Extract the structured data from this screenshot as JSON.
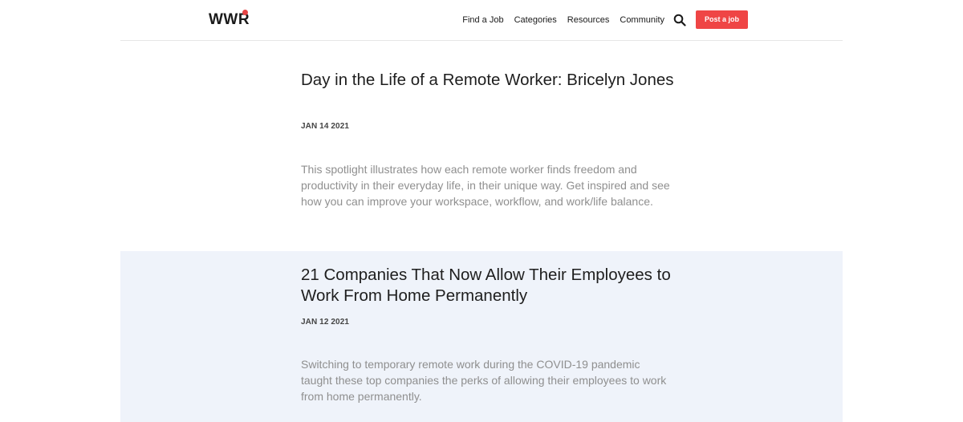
{
  "header": {
    "logo_text": "WWR",
    "nav": [
      {
        "label": "Find a Job"
      },
      {
        "label": "Categories"
      },
      {
        "label": "Resources"
      },
      {
        "label": "Community"
      }
    ],
    "search_icon": "search-icon",
    "post_job_label": "Post a job",
    "brand_color": "#ef4545"
  },
  "articles": [
    {
      "title": "Day in the Life of a Remote Worker: Bricelyn Jones",
      "date": "JAN 14 2021",
      "excerpt": "This spotlight illustrates how each remote worker finds freedom and productivity in their everyday life, in their unique way. Get inspired and see how you can improve your workspace, workflow, and work/life balance."
    },
    {
      "title": "21 Companies That Now Allow Their Employees to Work From Home Permanently",
      "date": "JAN 12 2021",
      "excerpt": "Switching to temporary remote work during the COVID-19 pandemic taught these top companies the perks of allowing their employees to work from home permanently."
    }
  ]
}
